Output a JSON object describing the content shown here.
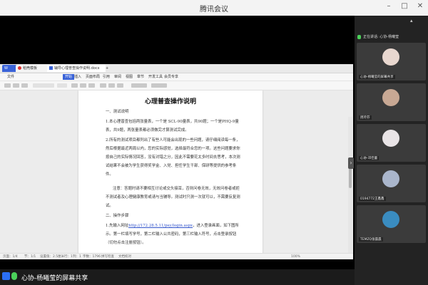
{
  "window": {
    "title": "腾讯会议"
  },
  "shared_screen": {
    "tabs": [
      {
        "label": "稻壳模板"
      },
      {
        "label": "辅导心理普查操作说明.docx"
      }
    ],
    "menu": [
      "文件",
      "开始",
      "插入",
      "页面布局",
      "引用",
      "审阅",
      "视图",
      "章节",
      "开发工具",
      "会员专享"
    ],
    "document": {
      "title": "心理普查操作说明",
      "paragraphs": [
        "一、测试说明",
        "1.本心理普查包括两张量表，一个是 SCL-90量表，共90题；一个是PHQ-9量表，共9题，两张量表都必须做完才算测试完成。",
        "2.所有的测试项目都列出了有些人可能会出现的一些问题，请仔细阅读每一条，然后根据最近两周以内，您的实际感觉，选择最符合您的一项。这些问题要求你按自己的实际情况回答，没有对错之分，因此不需要花太多时间去思考，本次测试结果不会被为学生获得奖学金、入党、担任学生干部、保研等提供的参考条件。",
        "注意：答题时请不要相互讨论或交头接耳，否则问卷无效，无效问卷者或拒不测试者及心理健康教育或请与当辅导。测试时只测一次就可以，不需要反复测试。",
        "二、操作步骤",
        "1.先输入网址",
        "http://172.28.5.11/psy/login.aspx",
        "，进入登录画面，如下图所示。第一栏填写学号，第二栏输入公共密码，第三栏输入符号，点击登录按钮（切勿点击注册按钮）。"
      ]
    },
    "status": [
      "页面：1/4",
      "节：1/1",
      "设置值：2.5厘米",
      "行：1",
      "列：1",
      "字数：1796",
      "拼写检查",
      "文档校对"
    ],
    "zoom": "100%"
  },
  "participants_panel": {
    "header": "正在讲话: 心协-杨曦莹",
    "tiles": [
      {
        "name": "心协-杨曦莹的屏幕共享",
        "avatar_color": "#e8d7cf"
      },
      {
        "name": "周玲芬",
        "avatar_color": "#c8a894"
      },
      {
        "name": "心协-邓佳蕾",
        "avatar_color": "#e9e4e6"
      },
      {
        "name": "0194772王鑫鑫",
        "avatar_color": "#aab6cc"
      },
      {
        "name": "TEMZQ张晨晨",
        "avatar_color": "#3a8cc0"
      }
    ]
  },
  "sharing_bar": {
    "label": "心协-杨曦莹的屏幕共享"
  },
  "colors": {
    "accent": "#2b6ff5",
    "link": "#3355cc",
    "speaking": "#4bd15a"
  }
}
